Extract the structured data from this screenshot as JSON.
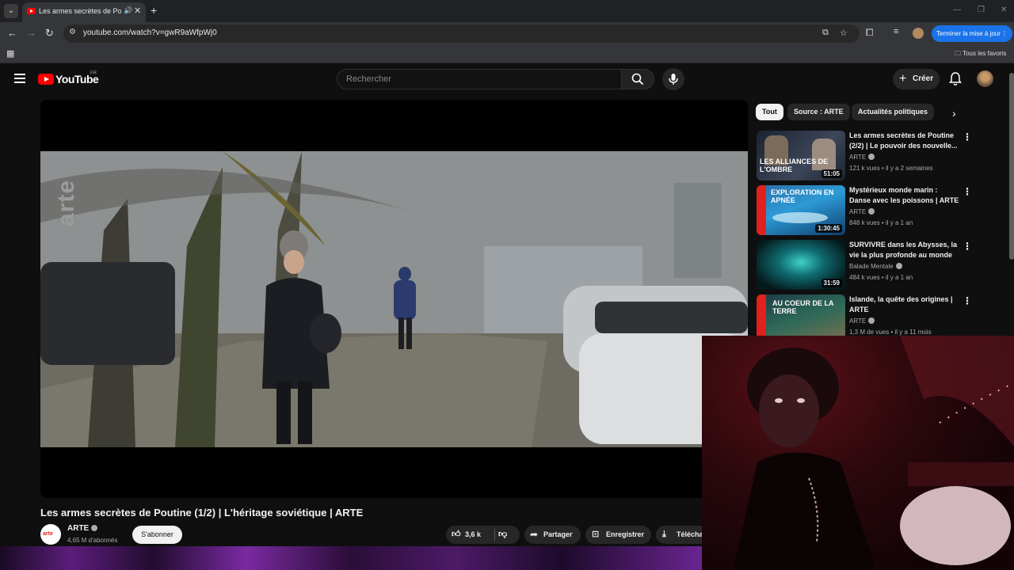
{
  "browser": {
    "tab_title": "Les armes secrètes de Poutine",
    "url": "youtube.com/watch?v=gwR9aWfpWj0",
    "update_button": "Terminer la mise à jour",
    "bookmarks_folder": "Tous les favoris"
  },
  "youtube": {
    "logo": "YouTube",
    "region": "FR",
    "search_placeholder": "Rechercher",
    "create_label": "Créer"
  },
  "video": {
    "watermark": "arte",
    "title": "Les armes secrètes de Poutine (1/2) | L'héritage soviétique | ARTE",
    "channel": "ARTE",
    "channel_logo": "arte",
    "subscribers": "4,65 M d'abonnés",
    "subscribe_label": "S'abonner",
    "likes": "3,6 k",
    "share_label": "Partager",
    "save_label": "Enregistrer",
    "download_label": "Téléchai"
  },
  "chips": [
    "Tout",
    "Source : ARTE",
    "Actualités politiques"
  ],
  "recommendations": [
    {
      "title": "Les armes secrètes de Poutine (2/2) | Le pouvoir des nouvelle...",
      "channel": "ARTE",
      "meta": "121 k vues • il y a 2 semaines",
      "duration": "51:05",
      "overlay": "LES ALLIANCES DE L'OMBRE",
      "thumb_color": "#27303d"
    },
    {
      "title": "Mystérieux monde marin : Danse avec les poissons | ARTE",
      "channel": "ARTE",
      "meta": "848 k vues • il y a 1 an",
      "duration": "1:30:45",
      "overlay": "EXPLORATION EN APNÉE",
      "thumb_color": "#1e7bc4"
    },
    {
      "title": "SURVIVRE dans les Abysses, la vie la plus profonde au monde",
      "channel": "Balade Mentale",
      "meta": "484 k vues • il y a 1 an",
      "duration": "31:59",
      "overlay": "",
      "thumb_color": "#0b3a3c"
    },
    {
      "title": "Islande, la quête des origines | ARTE",
      "channel": "ARTE",
      "meta": "1,3 M de vues • il y a 11 mois",
      "duration": "",
      "overlay": "AU COEUR DE LA TERRE",
      "thumb_color": "#2e5a4a"
    }
  ]
}
